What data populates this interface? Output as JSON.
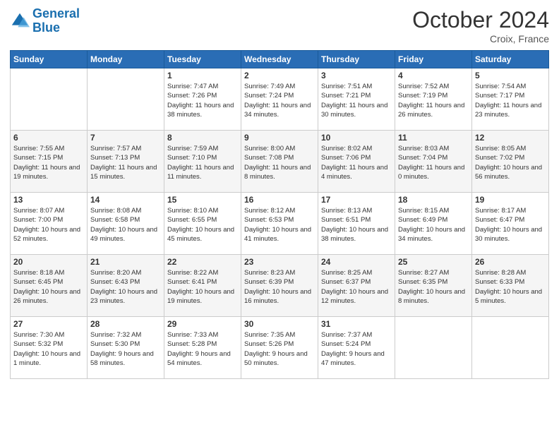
{
  "logo": {
    "line1": "General",
    "line2": "Blue"
  },
  "title": "October 2024",
  "location": "Croix, France",
  "weekdays": [
    "Sunday",
    "Monday",
    "Tuesday",
    "Wednesday",
    "Thursday",
    "Friday",
    "Saturday"
  ],
  "weeks": [
    [
      {
        "day": "",
        "sunrise": "",
        "sunset": "",
        "daylight": ""
      },
      {
        "day": "",
        "sunrise": "",
        "sunset": "",
        "daylight": ""
      },
      {
        "day": "1",
        "sunrise": "Sunrise: 7:47 AM",
        "sunset": "Sunset: 7:26 PM",
        "daylight": "Daylight: 11 hours and 38 minutes."
      },
      {
        "day": "2",
        "sunrise": "Sunrise: 7:49 AM",
        "sunset": "Sunset: 7:24 PM",
        "daylight": "Daylight: 11 hours and 34 minutes."
      },
      {
        "day": "3",
        "sunrise": "Sunrise: 7:51 AM",
        "sunset": "Sunset: 7:21 PM",
        "daylight": "Daylight: 11 hours and 30 minutes."
      },
      {
        "day": "4",
        "sunrise": "Sunrise: 7:52 AM",
        "sunset": "Sunset: 7:19 PM",
        "daylight": "Daylight: 11 hours and 26 minutes."
      },
      {
        "day": "5",
        "sunrise": "Sunrise: 7:54 AM",
        "sunset": "Sunset: 7:17 PM",
        "daylight": "Daylight: 11 hours and 23 minutes."
      }
    ],
    [
      {
        "day": "6",
        "sunrise": "Sunrise: 7:55 AM",
        "sunset": "Sunset: 7:15 PM",
        "daylight": "Daylight: 11 hours and 19 minutes."
      },
      {
        "day": "7",
        "sunrise": "Sunrise: 7:57 AM",
        "sunset": "Sunset: 7:13 PM",
        "daylight": "Daylight: 11 hours and 15 minutes."
      },
      {
        "day": "8",
        "sunrise": "Sunrise: 7:59 AM",
        "sunset": "Sunset: 7:10 PM",
        "daylight": "Daylight: 11 hours and 11 minutes."
      },
      {
        "day": "9",
        "sunrise": "Sunrise: 8:00 AM",
        "sunset": "Sunset: 7:08 PM",
        "daylight": "Daylight: 11 hours and 8 minutes."
      },
      {
        "day": "10",
        "sunrise": "Sunrise: 8:02 AM",
        "sunset": "Sunset: 7:06 PM",
        "daylight": "Daylight: 11 hours and 4 minutes."
      },
      {
        "day": "11",
        "sunrise": "Sunrise: 8:03 AM",
        "sunset": "Sunset: 7:04 PM",
        "daylight": "Daylight: 11 hours and 0 minutes."
      },
      {
        "day": "12",
        "sunrise": "Sunrise: 8:05 AM",
        "sunset": "Sunset: 7:02 PM",
        "daylight": "Daylight: 10 hours and 56 minutes."
      }
    ],
    [
      {
        "day": "13",
        "sunrise": "Sunrise: 8:07 AM",
        "sunset": "Sunset: 7:00 PM",
        "daylight": "Daylight: 10 hours and 52 minutes."
      },
      {
        "day": "14",
        "sunrise": "Sunrise: 8:08 AM",
        "sunset": "Sunset: 6:58 PM",
        "daylight": "Daylight: 10 hours and 49 minutes."
      },
      {
        "day": "15",
        "sunrise": "Sunrise: 8:10 AM",
        "sunset": "Sunset: 6:55 PM",
        "daylight": "Daylight: 10 hours and 45 minutes."
      },
      {
        "day": "16",
        "sunrise": "Sunrise: 8:12 AM",
        "sunset": "Sunset: 6:53 PM",
        "daylight": "Daylight: 10 hours and 41 minutes."
      },
      {
        "day": "17",
        "sunrise": "Sunrise: 8:13 AM",
        "sunset": "Sunset: 6:51 PM",
        "daylight": "Daylight: 10 hours and 38 minutes."
      },
      {
        "day": "18",
        "sunrise": "Sunrise: 8:15 AM",
        "sunset": "Sunset: 6:49 PM",
        "daylight": "Daylight: 10 hours and 34 minutes."
      },
      {
        "day": "19",
        "sunrise": "Sunrise: 8:17 AM",
        "sunset": "Sunset: 6:47 PM",
        "daylight": "Daylight: 10 hours and 30 minutes."
      }
    ],
    [
      {
        "day": "20",
        "sunrise": "Sunrise: 8:18 AM",
        "sunset": "Sunset: 6:45 PM",
        "daylight": "Daylight: 10 hours and 26 minutes."
      },
      {
        "day": "21",
        "sunrise": "Sunrise: 8:20 AM",
        "sunset": "Sunset: 6:43 PM",
        "daylight": "Daylight: 10 hours and 23 minutes."
      },
      {
        "day": "22",
        "sunrise": "Sunrise: 8:22 AM",
        "sunset": "Sunset: 6:41 PM",
        "daylight": "Daylight: 10 hours and 19 minutes."
      },
      {
        "day": "23",
        "sunrise": "Sunrise: 8:23 AM",
        "sunset": "Sunset: 6:39 PM",
        "daylight": "Daylight: 10 hours and 16 minutes."
      },
      {
        "day": "24",
        "sunrise": "Sunrise: 8:25 AM",
        "sunset": "Sunset: 6:37 PM",
        "daylight": "Daylight: 10 hours and 12 minutes."
      },
      {
        "day": "25",
        "sunrise": "Sunrise: 8:27 AM",
        "sunset": "Sunset: 6:35 PM",
        "daylight": "Daylight: 10 hours and 8 minutes."
      },
      {
        "day": "26",
        "sunrise": "Sunrise: 8:28 AM",
        "sunset": "Sunset: 6:33 PM",
        "daylight": "Daylight: 10 hours and 5 minutes."
      }
    ],
    [
      {
        "day": "27",
        "sunrise": "Sunrise: 7:30 AM",
        "sunset": "Sunset: 5:32 PM",
        "daylight": "Daylight: 10 hours and 1 minute."
      },
      {
        "day": "28",
        "sunrise": "Sunrise: 7:32 AM",
        "sunset": "Sunset: 5:30 PM",
        "daylight": "Daylight: 9 hours and 58 minutes."
      },
      {
        "day": "29",
        "sunrise": "Sunrise: 7:33 AM",
        "sunset": "Sunset: 5:28 PM",
        "daylight": "Daylight: 9 hours and 54 minutes."
      },
      {
        "day": "30",
        "sunrise": "Sunrise: 7:35 AM",
        "sunset": "Sunset: 5:26 PM",
        "daylight": "Daylight: 9 hours and 50 minutes."
      },
      {
        "day": "31",
        "sunrise": "Sunrise: 7:37 AM",
        "sunset": "Sunset: 5:24 PM",
        "daylight": "Daylight: 9 hours and 47 minutes."
      },
      {
        "day": "",
        "sunrise": "",
        "sunset": "",
        "daylight": ""
      },
      {
        "day": "",
        "sunrise": "",
        "sunset": "",
        "daylight": ""
      }
    ]
  ]
}
